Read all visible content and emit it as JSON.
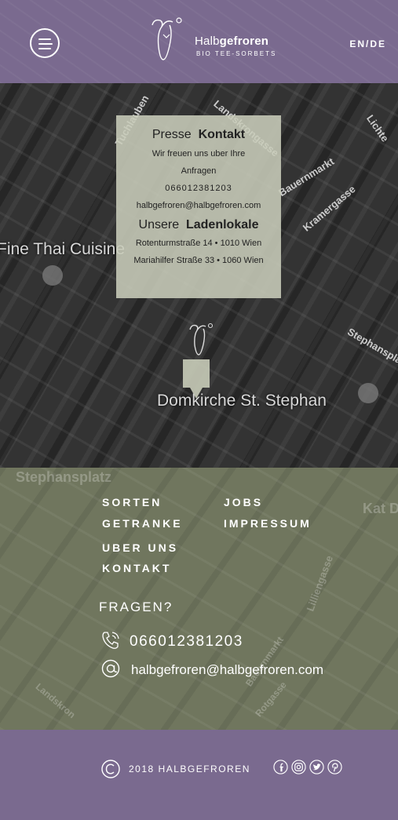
{
  "header": {
    "brand_light": "Halb",
    "brand_bold": "gefroren",
    "brand_sub": "BIO TEE-SORBETS",
    "lang": "EN/DE"
  },
  "map": {
    "streets": [
      "Tuchlauben",
      "Landskrongasse",
      "Lichte",
      "Bauernmarkt",
      "Kramergasse",
      "Stephansplatz"
    ],
    "labels": [
      "Fine Thai Cuisine",
      "Domkirche St. Stephan"
    ],
    "contact": {
      "heading_light": "Presse",
      "heading_bold": "Kontakt",
      "line1": "Wir freuen uns uber Ihre",
      "line2": "Anfragen",
      "phone": "066012381203",
      "email": "halbgefroren@halbgefroren.com",
      "heading2_light": "Unsere",
      "heading2_bold": "Ladenlokale",
      "address1": "Rotenturmstraße 14 • 1010 Wien",
      "address2": "Mariahilfer Straße 33 • 1060 Wien"
    }
  },
  "footer": {
    "nav": [
      "SORTEN",
      "GETRANKE",
      "UBER UNS",
      "KONTAKT",
      "JOBS",
      "IMPRESSUM"
    ],
    "faq": "FRAGEN?",
    "phone": "066012381203",
    "email": "halbgefroren@halbgefroren.com",
    "bg_labels": [
      "Stephansplatz",
      "Kat Deu",
      "Lilliengasse",
      "Bauernmarkt",
      "Rotgasse",
      "Landskron"
    ]
  },
  "bottom": {
    "copyright": "2018 HALBGEFROREN",
    "social_icons": [
      "facebook-icon",
      "instagram-icon",
      "twitter-icon",
      "pinterest-icon"
    ]
  },
  "colors": {
    "purple": "#7a6a8f",
    "olive": "#70765e",
    "contact_box": "#c8ccb9"
  }
}
